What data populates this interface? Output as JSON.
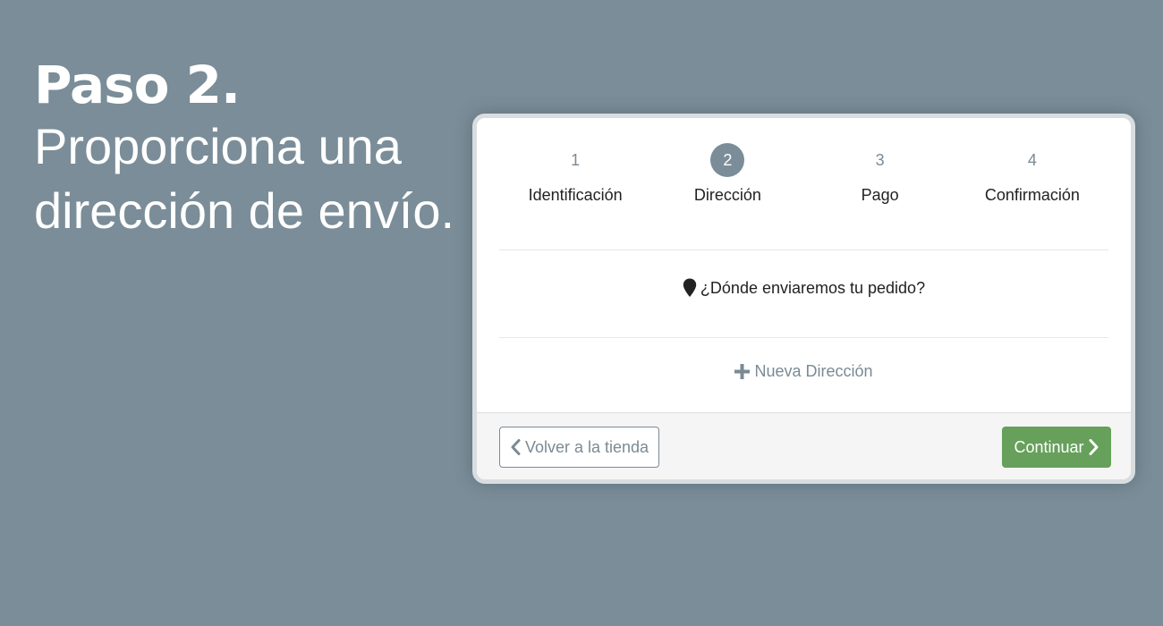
{
  "heading": {
    "step": "Paso 2.",
    "description_line1": "Proporciona una",
    "description_line2": "dirección de envío."
  },
  "checkout": {
    "steps": [
      {
        "number": "1",
        "label": "Identificación",
        "active": false
      },
      {
        "number": "2",
        "label": "Dirección",
        "active": true
      },
      {
        "number": "3",
        "label": "Pago",
        "active": false
      },
      {
        "number": "4",
        "label": "Confirmación",
        "active": false
      }
    ],
    "question": "¿Dónde enviaremos tu pedido?",
    "new_address_label": "Nueva Dirección",
    "back_button_label": "Volver a la tienda",
    "continue_button_label": "Continuar"
  },
  "icons": {
    "question": "map-pin-icon",
    "new_address": "plus-icon",
    "back": "chevron-left-icon",
    "continue": "chevron-right-icon"
  },
  "colors": {
    "background": "#7a8d98",
    "active_step": "#7a8d98",
    "continue_button": "#66a05b",
    "muted_text": "#7a8a95"
  }
}
